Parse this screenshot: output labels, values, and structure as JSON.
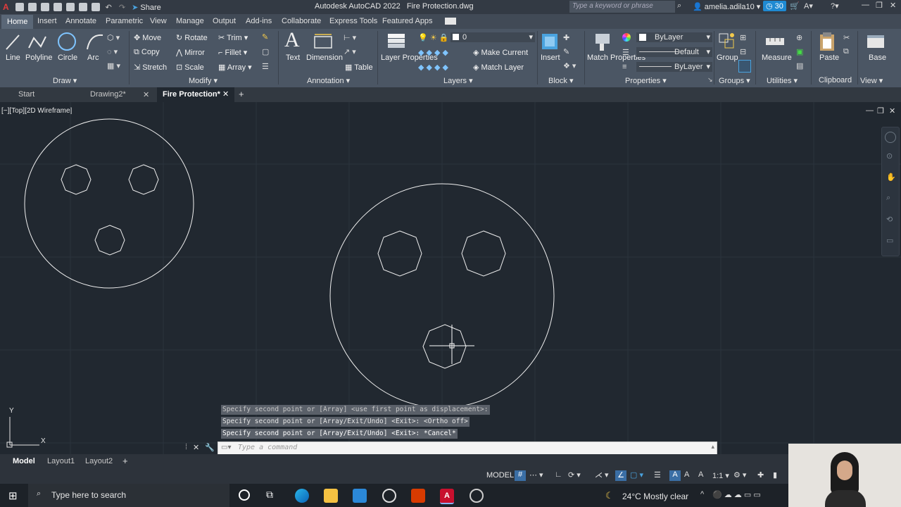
{
  "window": {
    "title": "Autodesk AutoCAD 2022",
    "file_title": "Fire Protection.dwg",
    "search_placeholder": "Type a keyword or phrase",
    "user": "amelia.adila10",
    "timer_badge": "30",
    "share_label": "Share"
  },
  "ribbon_tabs": [
    "Home",
    "Insert",
    "Annotate",
    "Parametric",
    "View",
    "Manage",
    "Output",
    "Add-ins",
    "Collaborate",
    "Express Tools",
    "Featured Apps"
  ],
  "draw": {
    "line": "Line",
    "polyline": "Polyline",
    "circle": "Circle",
    "arc": "Arc",
    "title": "Draw"
  },
  "modify": {
    "move": "Move",
    "rotate": "Rotate",
    "trim": "Trim",
    "copy": "Copy",
    "mirror": "Mirror",
    "fillet": "Fillet",
    "stretch": "Stretch",
    "scale": "Scale",
    "array": "Array",
    "title": "Modify"
  },
  "annotation": {
    "text": "Text",
    "dimension": "Dimension",
    "table": "Table",
    "title": "Annotation"
  },
  "layers": {
    "properties": "Layer Properties",
    "current_layer": "0",
    "make_current": "Make Current",
    "match_layer": "Match Layer",
    "title": "Layers"
  },
  "block": {
    "insert": "Insert",
    "title": "Block"
  },
  "properties": {
    "match": "Match Properties",
    "color": "ByLayer",
    "linetype": "Default",
    "lineweight": "ByLayer",
    "title": "Properties"
  },
  "groups": {
    "group": "Group",
    "title": "Groups"
  },
  "utilities": {
    "measure": "Measure",
    "title": "Utilities"
  },
  "clipboard": {
    "paste": "Paste",
    "title": "Clipboard"
  },
  "view": {
    "base": "Base",
    "title": "View"
  },
  "file_tabs": {
    "start": "Start",
    "drawing2": "Drawing2*",
    "fire": "Fire Protection*"
  },
  "viewport_label": "[−][Top][2D Wireframe]",
  "command_history": [
    "Specify second point or [Array] <use first point as displacement>:",
    "Specify second point or [Array/Exit/Undo] <Exit>:  <Ortho off>",
    "Specify second point or [Array/Exit/Undo] <Exit>: *Cancel*"
  ],
  "command_placeholder": "Type a command",
  "layout_tabs": {
    "model": "Model",
    "layout1": "Layout1",
    "layout2": "Layout2"
  },
  "status": {
    "model": "MODEL",
    "scale": "1:1"
  },
  "taskbar": {
    "search_placeholder": "Type here to search",
    "weather": "24°C  Mostly clear"
  },
  "colors": {
    "accent": "#1f8ad2",
    "viewport": "#212830",
    "ribbon": "#4b5664"
  },
  "ucs": {
    "x": "X",
    "y": "Y"
  }
}
